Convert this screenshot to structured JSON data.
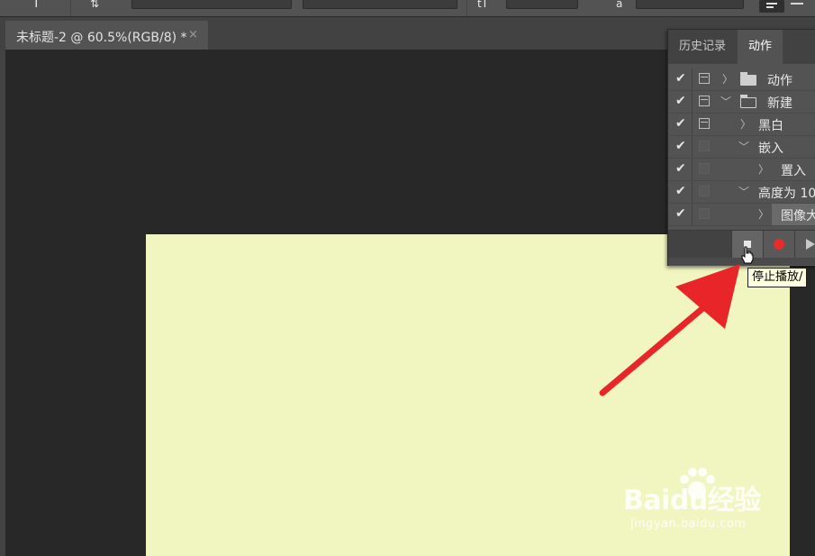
{
  "document": {
    "tab_title": "未标题-2 @ 60.5%(RGB/8) *",
    "close_glyph": "×",
    "canvas_color": "#f1f6c0"
  },
  "options_bar": {
    "type_tool_glyph": "T",
    "size_glyph": "tT",
    "aa_glyph": "a"
  },
  "actions_panel": {
    "tabs": [
      {
        "label": "历史记录",
        "active": false
      },
      {
        "label": "动作",
        "active": true
      }
    ],
    "rows": [
      {
        "label": "动作",
        "checked": true,
        "dialog": true,
        "expanded": false,
        "kind": "set"
      },
      {
        "label": "新建",
        "checked": true,
        "dialog": true,
        "expanded": true,
        "kind": "set"
      },
      {
        "label": "黑白",
        "checked": true,
        "dialog": true,
        "expanded": false,
        "kind": "action"
      },
      {
        "label": "嵌入",
        "checked": true,
        "dialog": false,
        "expanded": true,
        "kind": "action"
      },
      {
        "label": "置入",
        "checked": true,
        "dialog": false,
        "expanded": false,
        "kind": "command"
      },
      {
        "label": "高度为 10",
        "checked": true,
        "dialog": false,
        "expanded": true,
        "kind": "action"
      },
      {
        "label": "图像大",
        "checked": true,
        "dialog": false,
        "expanded": false,
        "kind": "command"
      }
    ],
    "check_glyph": "✔",
    "collapsed_glyph": "〉",
    "expanded_glyph": "﹀",
    "buttons": [
      {
        "name": "stop-playing-recording",
        "icon": "stop-icon"
      },
      {
        "name": "begin-recording",
        "icon": "record-icon",
        "color": "#e82c2c"
      },
      {
        "name": "play-selection",
        "icon": "play-icon"
      }
    ]
  },
  "tooltip": {
    "text": "停止播放/"
  },
  "annotation": {
    "arrow_color": "#e8262a"
  },
  "watermark": {
    "logo_text": "Baidu经验",
    "url": "jingyan.baidu.com"
  }
}
